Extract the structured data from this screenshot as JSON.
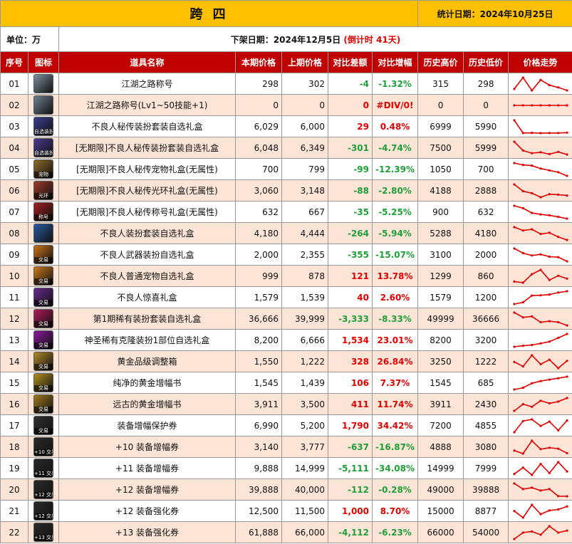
{
  "header": {
    "title": "跨 四",
    "stat_date": "统计日期：2024年10月25日",
    "unit": "单位：万",
    "offshelf": "下架日期：2024年12月5日",
    "countdown": "(倒计时 41天)"
  },
  "columns": [
    "序号",
    "图标",
    "道具名称",
    "本期价格",
    "上期价格",
    "对比差额",
    "对比增幅",
    "历史高价",
    "历史低价",
    "价格走势"
  ],
  "colors": {
    "title_bg": "#ffc000",
    "header_bg": "#c00000",
    "stripe": "#fce4d6",
    "positive": "#e00000",
    "negative": "#1f9e3a",
    "sparkline": "#e00000"
  },
  "rows": [
    {
      "no": "01",
      "icon": "jianghu-title-icon",
      "icon_color": "#7f8fa0",
      "name": "江湖之路称号",
      "cur": "298",
      "prev": "302",
      "diff": "-4",
      "pct": "-1.32%",
      "high": "315",
      "low": "298",
      "dir": "neg",
      "trend": [
        300,
        315,
        298,
        312,
        305,
        302,
        298
      ]
    },
    {
      "no": "02",
      "icon": "jianghu-title-skill-icon",
      "icon_color": "#6f7f90",
      "name": "江湖之路称号(Lv1~50技能+1)",
      "cur": "0",
      "prev": "0",
      "diff": "0",
      "pct": "#DIV/0!",
      "high": "0",
      "low": "0",
      "dir": "pos",
      "trend": [
        0,
        0,
        0,
        0,
        0,
        0,
        0
      ]
    },
    {
      "no": "03",
      "icon": "outfit-box-icon",
      "icon_color": "#3b3f8f",
      "icon_text": "自选装扮",
      "name": "不良人秘传装扮套装自选礼盒",
      "cur": "6,029",
      "prev": "6,000",
      "diff": "29",
      "pct": "0.48%",
      "high": "6999",
      "low": "5990",
      "dir": "pos",
      "trend": [
        6999,
        6000,
        6010,
        5990,
        6000,
        6000,
        6029
      ]
    },
    {
      "no": "04",
      "icon": "outfit-box-icon",
      "icon_color": "#4a3a8f",
      "icon_text": "自选装扮",
      "name": "[无期限]不良人秘传装扮套装自选礼盒",
      "cur": "6,048",
      "prev": "6,349",
      "diff": "-301",
      "pct": "-4.74%",
      "high": "7500",
      "low": "5999",
      "dir": "neg",
      "trend": [
        7500,
        6500,
        6200,
        6300,
        6100,
        6349,
        6048
      ]
    },
    {
      "no": "05",
      "icon": "pet-box-icon",
      "icon_color": "#8f6a2a",
      "icon_text": "宠物",
      "name": "[无期限]不良人秘传宠物礼盒(无属性)",
      "cur": "700",
      "prev": "799",
      "diff": "-99",
      "pct": "-12.39%",
      "high": "1050",
      "low": "700",
      "dir": "neg",
      "trend": [
        1050,
        1000,
        980,
        900,
        850,
        799,
        700
      ]
    },
    {
      "no": "06",
      "icon": "aura-box-icon",
      "icon_color": "#9a3a2a",
      "icon_text": "光环",
      "name": "[无期限]不良人秘传光环礼盒(无属性)",
      "cur": "3,060",
      "prev": "3,148",
      "diff": "-88",
      "pct": "-2.80%",
      "high": "4188",
      "low": "2888",
      "dir": "neg",
      "trend": [
        4188,
        3500,
        3300,
        2888,
        3200,
        3148,
        3060
      ]
    },
    {
      "no": "07",
      "icon": "title-box-icon",
      "icon_color": "#a02020",
      "icon_text": "称号",
      "name": "[无期限]不良人秘传称号礼盒(无属性)",
      "cur": "632",
      "prev": "667",
      "diff": "-35",
      "pct": "-5.25%",
      "high": "900",
      "low": "632",
      "dir": "neg",
      "trend": [
        900,
        850,
        750,
        720,
        700,
        667,
        632
      ]
    },
    {
      "no": "08",
      "icon": "outfit-set-box-icon",
      "icon_color": "#2a5aa0",
      "name": "不良人装扮套装自选礼盒",
      "cur": "4,180",
      "prev": "4,444",
      "diff": "-264",
      "pct": "-5.94%",
      "high": "5288",
      "low": "4180",
      "dir": "neg",
      "trend": [
        5288,
        5000,
        5100,
        4700,
        4800,
        4444,
        4180
      ]
    },
    {
      "no": "09",
      "icon": "weapon-box-icon",
      "icon_color": "#c8701a",
      "icon_text": "交易",
      "name": "不良人武器装扮自选礼盒",
      "cur": "2,000",
      "prev": "2,355",
      "diff": "-355",
      "pct": "-15.07%",
      "high": "3100",
      "low": "2000",
      "dir": "neg",
      "trend": [
        3100,
        2700,
        2500,
        2600,
        2400,
        2355,
        2000
      ]
    },
    {
      "no": "10",
      "icon": "common-pet-box-icon",
      "icon_color": "#c87a1a",
      "icon_text": "交易",
      "name": "不良人普通宠物自选礼盒",
      "cur": "999",
      "prev": "878",
      "diff": "121",
      "pct": "13.78%",
      "high": "1299",
      "low": "860",
      "dir": "pos",
      "trend": [
        900,
        860,
        1150,
        1299,
        950,
        1100,
        999
      ]
    },
    {
      "no": "11",
      "icon": "surprise-box-icon",
      "icon_color": "#6a2a8f",
      "icon_text": "交易",
      "name": "不良人惊喜礼盒",
      "cur": "1,579",
      "prev": "1,539",
      "diff": "40",
      "pct": "2.60%",
      "high": "1579",
      "low": "1200",
      "dir": "pos",
      "trend": [
        1200,
        1250,
        1450,
        1460,
        1480,
        1539,
        1579
      ]
    },
    {
      "no": "12",
      "icon": "rare-outfit-box-icon",
      "icon_color": "#b01a5a",
      "icon_text": "交易",
      "name": "第1期稀有装扮套装自选礼盒",
      "cur": "36,666",
      "prev": "39,999",
      "diff": "-3,333",
      "pct": "-8.33%",
      "high": "49999",
      "low": "36666",
      "dir": "neg",
      "trend": [
        49999,
        45000,
        46000,
        40000,
        41000,
        39999,
        36666
      ]
    },
    {
      "no": "13",
      "icon": "clone-outfit-box-icon",
      "icon_color": "#8a1a9a",
      "icon_text": "交易",
      "name": "神圣稀有克隆装扮1部位自选礼盒",
      "cur": "8,200",
      "prev": "6,666",
      "diff": "1,534",
      "pct": "23.01%",
      "high": "8200",
      "low": "3200",
      "dir": "pos",
      "trend": [
        3200,
        3600,
        3900,
        4500,
        5200,
        6666,
        8200
      ]
    },
    {
      "no": "14",
      "icon": "gold-adjust-box-icon",
      "icon_color": "#b0882a",
      "icon_text": "交易",
      "name": "黄金品级调整箱",
      "cur": "1,550",
      "prev": "1,222",
      "diff": "328",
      "pct": "26.84%",
      "high": "3250",
      "low": "1222",
      "dir": "pos",
      "trend": [
        1500,
        1300,
        1800,
        1400,
        1600,
        1222,
        1550
      ]
    },
    {
      "no": "15",
      "icon": "pure-gold-amplify-icon",
      "icon_color": "#b09020",
      "icon_text": "交易",
      "name": "纯净的黄金增幅书",
      "cur": "1,545",
      "prev": "1,439",
      "diff": "106",
      "pct": "7.37%",
      "high": "1545",
      "low": "685",
      "dir": "pos",
      "trend": [
        685,
        800,
        1100,
        1250,
        1350,
        1439,
        1545
      ]
    },
    {
      "no": "16",
      "icon": "ancient-gold-amplify-icon",
      "icon_color": "#a07a1a",
      "icon_text": "交易",
      "name": "远古的黄金增幅书",
      "cur": "3,911",
      "prev": "3,500",
      "diff": "411",
      "pct": "11.74%",
      "high": "3911",
      "low": "2430",
      "dir": "pos",
      "trend": [
        2430,
        3200,
        2900,
        3600,
        3300,
        3500,
        3911
      ]
    },
    {
      "no": "17",
      "icon": "amplify-protect-icon",
      "icon_color": "#303030",
      "icon_text": "交易",
      "name": "装备增幅保护券",
      "cur": "6,990",
      "prev": "5,200",
      "diff": "1,790",
      "pct": "34.42%",
      "high": "7200",
      "low": "4855",
      "dir": "pos",
      "trend": [
        4855,
        6900,
        7200,
        6000,
        6800,
        5200,
        6990
      ]
    },
    {
      "no": "18",
      "icon": "amplify-10-icon",
      "icon_color": "#2a2a2a",
      "icon_text": "+10 交易",
      "name": "+10 装备增幅券",
      "cur": "3,140",
      "prev": "3,777",
      "diff": "-637",
      "pct": "-16.87%",
      "high": "4888",
      "low": "3080",
      "dir": "neg",
      "trend": [
        3500,
        3080,
        4888,
        3700,
        3900,
        3777,
        3140
      ]
    },
    {
      "no": "19",
      "icon": "amplify-11-icon",
      "icon_color": "#2a2a2a",
      "icon_text": "+11 交易",
      "name": "+11 装备增幅券",
      "cur": "9,888",
      "prev": "14,999",
      "diff": "-5,111",
      "pct": "-34.08%",
      "high": "14999",
      "low": "7999",
      "dir": "neg",
      "trend": [
        8500,
        12000,
        7999,
        14000,
        9000,
        14999,
        9888
      ]
    },
    {
      "no": "20",
      "icon": "amplify-12-icon",
      "icon_color": "#2a2a2a",
      "icon_text": "+12 交易",
      "name": "+12 装备增幅券",
      "cur": "39,888",
      "prev": "40,000",
      "diff": "-112",
      "pct": "-0.28%",
      "high": "49000",
      "low": "39888",
      "dir": "neg",
      "trend": [
        49000,
        45000,
        46000,
        44000,
        45000,
        40000,
        39888
      ]
    },
    {
      "no": "21",
      "icon": "reinforce-12-icon",
      "icon_color": "#2a2a2a",
      "icon_text": "+12 交易",
      "name": "+12 装备强化券",
      "cur": "12,500",
      "prev": "11,500",
      "diff": "1,000",
      "pct": "8.70%",
      "high": "15000",
      "low": "8877",
      "dir": "pos",
      "trend": [
        11000,
        8877,
        13000,
        10000,
        11200,
        11500,
        12500
      ]
    },
    {
      "no": "22",
      "icon": "reinforce-13-icon",
      "icon_color": "#2a2a2a",
      "icon_text": "+13 交易",
      "name": "+13 装备强化券",
      "cur": "61,888",
      "prev": "66,000",
      "diff": "-4,112",
      "pct": "-6.23%",
      "high": "66000",
      "low": "54000",
      "dir": "neg",
      "trend": [
        54000,
        60000,
        61000,
        58000,
        66000,
        60000,
        61888
      ]
    }
  ]
}
